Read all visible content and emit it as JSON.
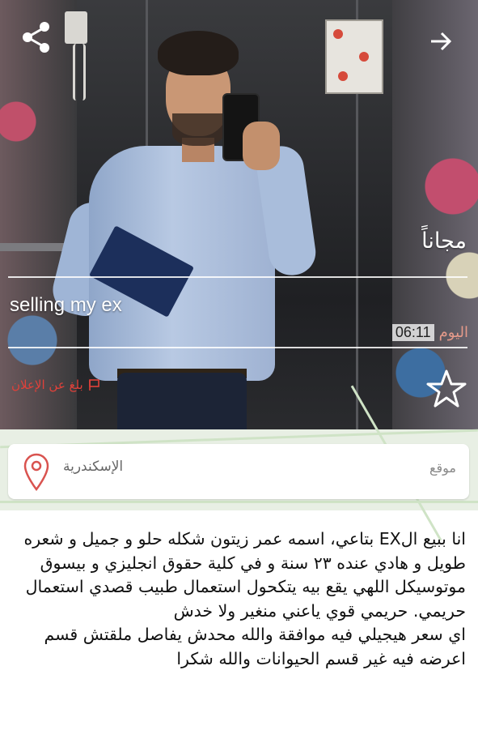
{
  "listing": {
    "price": "مجاناً",
    "title": "selling my ex",
    "time_label": "اليوم",
    "time_value": "06:11",
    "report_label": "بلغ عن الإعلان"
  },
  "location": {
    "label": "موقع",
    "city": "الإسكندرية"
  },
  "description": "انا ببيع الEX بتاعي، اسمه عمر زيتون شكله حلو و جميل و شعره طويل و هادي عنده ٢٣ سنة و في كلية حقوق انجليزي و بيسوق موتوسيكل اللهي يقع بيه يتكحول استعمال طبيب قصدي استعمال حريمي. حريمي قوي ياعني منغير ولا خدش\nاي سعر هيجيلي فيه موافقة والله محدش يفاصل ملقتش قسم اعرضه فيه غير قسم الحيوانات والله شكرا",
  "icons": {
    "share": "share-icon",
    "forward": "forward-arrow-icon",
    "report": "flag-icon",
    "favorite": "star-icon",
    "pin": "location-pin-icon"
  },
  "colors": {
    "report_red": "#e0413a",
    "time_label": "#e59a8a"
  }
}
